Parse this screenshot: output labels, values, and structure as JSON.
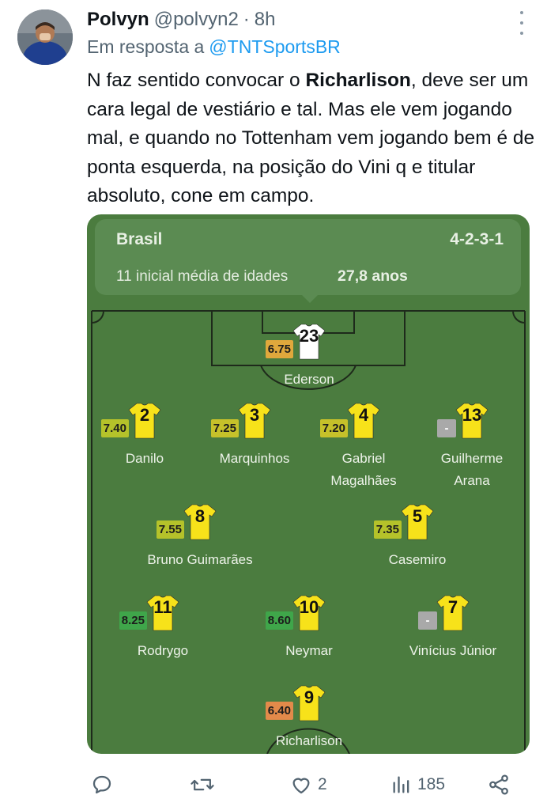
{
  "tweet": {
    "author_name": "Polvyn",
    "author_handle": "@polvyn2",
    "separator": "·",
    "time": "8h",
    "reply_prefix": "Em resposta a",
    "reply_target": "@TNTSportsBR",
    "text_before": "N faz sentido convocar o ",
    "text_bold": "Richarlison",
    "text_after": ", deve ser um cara legal de vestiário e tal. Mas ele vem jogando mal, e quando no Tottenham vem jogando bem é de ponta esquerda, na posição do Vini q e titular absoluto, cone em campo."
  },
  "lineup": {
    "team": "Brasil",
    "formation": "4-2-3-1",
    "age_label": "11 inicial média de idades",
    "age_value": "27,8 anos",
    "players": [
      {
        "number": "23",
        "name": "Ederson",
        "rating": "6.75",
        "rating_color": "#e0a83c",
        "shirt_color": "#ffffff"
      },
      {
        "number": "2",
        "name": "Danilo",
        "rating": "7.40",
        "rating_color": "#b5c22a",
        "shirt_color": "#f7e21a"
      },
      {
        "number": "3",
        "name": "Marquinhos",
        "rating": "7.25",
        "rating_color": "#c6c12a",
        "shirt_color": "#f7e21a"
      },
      {
        "number": "4",
        "name": "Gabriel\nMagalhães",
        "rating": "7.20",
        "rating_color": "#c6c12a",
        "shirt_color": "#f7e21a"
      },
      {
        "number": "13",
        "name": "Guilherme\nArana",
        "rating": "-",
        "rating_color": "#a9a9a9",
        "shirt_color": "#f7e21a"
      },
      {
        "number": "8",
        "name": "Bruno Guimarães",
        "rating": "7.55",
        "rating_color": "#b5c22a",
        "shirt_color": "#f7e21a"
      },
      {
        "number": "5",
        "name": "Casemiro",
        "rating": "7.35",
        "rating_color": "#b5c22a",
        "shirt_color": "#f7e21a"
      },
      {
        "number": "11",
        "name": "Rodrygo",
        "rating": "8.25",
        "rating_color": "#3fa64a",
        "shirt_color": "#f7e21a"
      },
      {
        "number": "10",
        "name": "Neymar",
        "rating": "8.60",
        "rating_color": "#3fa64a",
        "shirt_color": "#f7e21a"
      },
      {
        "number": "7",
        "name": "Vinícius Júnior",
        "rating": "-",
        "rating_color": "#a9a9a9",
        "shirt_color": "#f7e21a"
      },
      {
        "number": "9",
        "name": "Richarlison",
        "rating": "6.40",
        "rating_color": "#e38a4a",
        "shirt_color": "#f7e21a"
      }
    ]
  },
  "actions": {
    "reply_icon": "reply-icon",
    "retweet_icon": "retweet-icon",
    "like_icon": "heart-icon",
    "like_count": "2",
    "views_icon": "views-icon",
    "views_count": "185",
    "share_icon": "share-icon"
  },
  "colors": {
    "pitch_green": "#4b7c3f",
    "link_blue": "#1d9bf0",
    "muted_gray": "#536471"
  }
}
